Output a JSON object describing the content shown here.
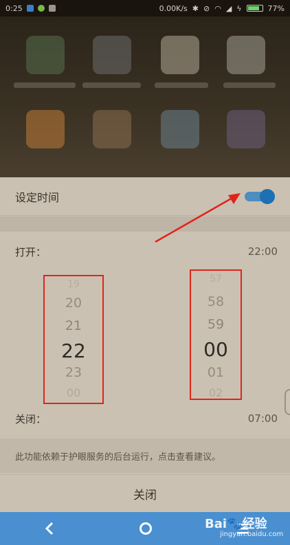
{
  "status_bar": {
    "time": "0:25",
    "network_speed": "0.00K/s",
    "battery": "77%"
  },
  "settings": {
    "schedule_label": "设定时间",
    "schedule_enabled": true,
    "open_label": "打开：",
    "open_time": "22:00",
    "close_label": "关闭：",
    "close_time": "07:00",
    "hint": "此功能依赖于护眼服务的后台运行，点击查看建议。",
    "close_button": "关闭"
  },
  "hour_picker": {
    "top_partial": "19",
    "items": [
      "20",
      "21",
      "22",
      "23",
      "00"
    ]
  },
  "minute_picker": {
    "top_partial": "57",
    "items": [
      "58",
      "59",
      "00",
      "01",
      "02"
    ]
  },
  "watermark": {
    "brand": "Bai",
    "brand2": "经验",
    "url": "jingyan.baidu.com"
  },
  "colors": {
    "highlight_box": "#e0241c",
    "toggle_on": "#1e6fb3",
    "nav_bar": "#4a8fd0"
  }
}
